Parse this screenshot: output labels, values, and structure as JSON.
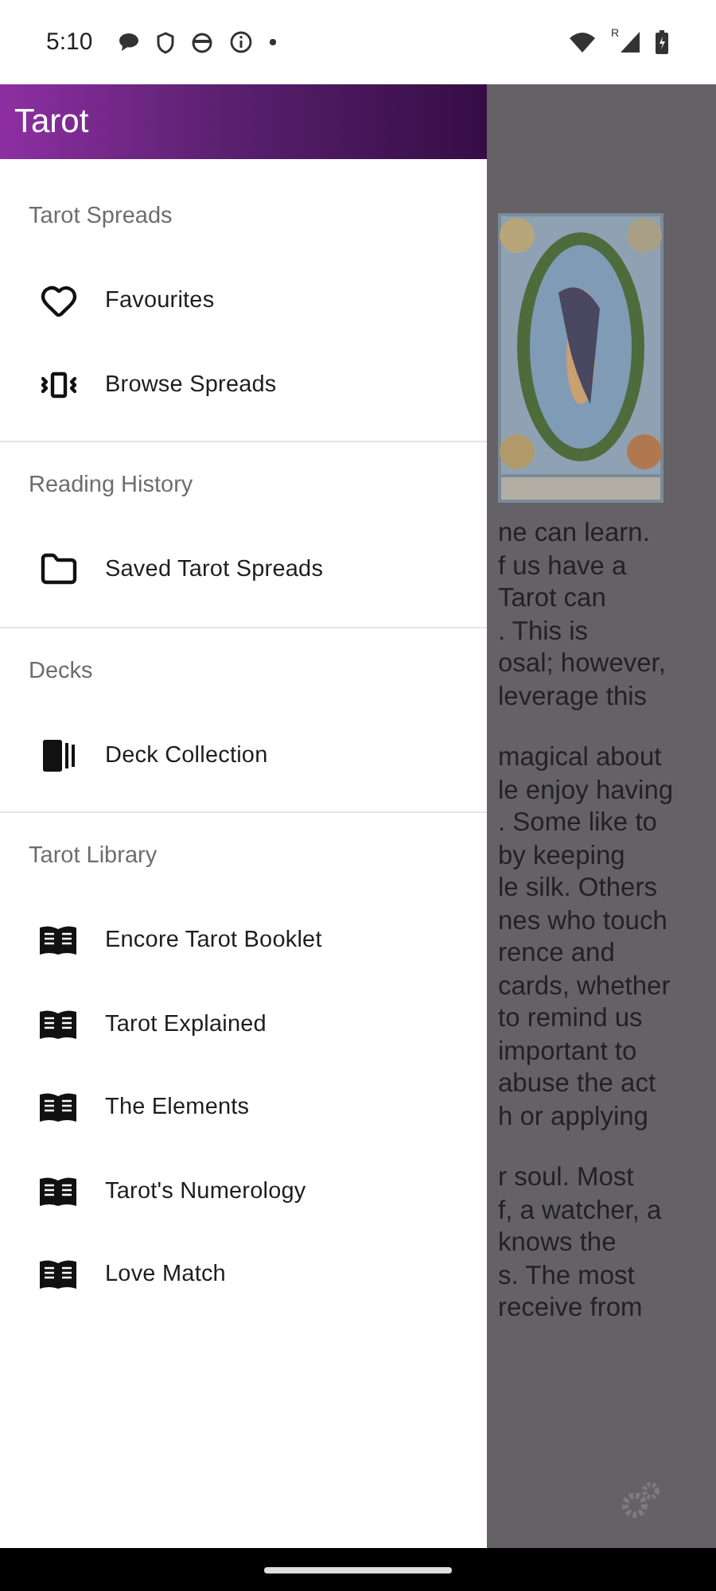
{
  "status_bar": {
    "time": "5:10",
    "signal_badge": "R"
  },
  "drawer": {
    "title": "Tarot",
    "sections": [
      {
        "header": "Tarot Spreads",
        "items": [
          {
            "label": "Favourites",
            "kind": "heart"
          },
          {
            "label": "Browse Spreads",
            "kind": "carousel"
          }
        ]
      },
      {
        "header": "Reading History",
        "items": [
          {
            "label": "Saved Tarot Spreads",
            "kind": "folder"
          }
        ]
      },
      {
        "header": "Decks",
        "items": [
          {
            "label": "Deck Collection",
            "kind": "deck"
          }
        ]
      },
      {
        "header": "Tarot Library",
        "items": [
          {
            "label": "Encore Tarot Booklet",
            "kind": "book"
          },
          {
            "label": "Tarot Explained",
            "kind": "book"
          },
          {
            "label": "The Elements",
            "kind": "book"
          },
          {
            "label": "Tarot's Numerology",
            "kind": "book"
          },
          {
            "label": "Love Match",
            "kind": "book"
          }
        ]
      }
    ]
  },
  "background": {
    "card": {
      "kind": "picture"
    },
    "paragraphs": [
      [
        "ne can learn.",
        "f us have a",
        "Tarot can",
        ". This is",
        "osal; however,",
        "leverage this"
      ],
      [
        "magical about",
        "le enjoy having",
        ". Some like to",
        "by keeping",
        "le silk. Others",
        "nes who touch",
        "rence and",
        "cards, whether",
        "to remind us",
        "important to",
        "abuse the act",
        "h or applying"
      ],
      [
        "r soul. Most",
        "f, a watcher, a",
        "knows the",
        "s. The most",
        "receive from"
      ]
    ]
  }
}
